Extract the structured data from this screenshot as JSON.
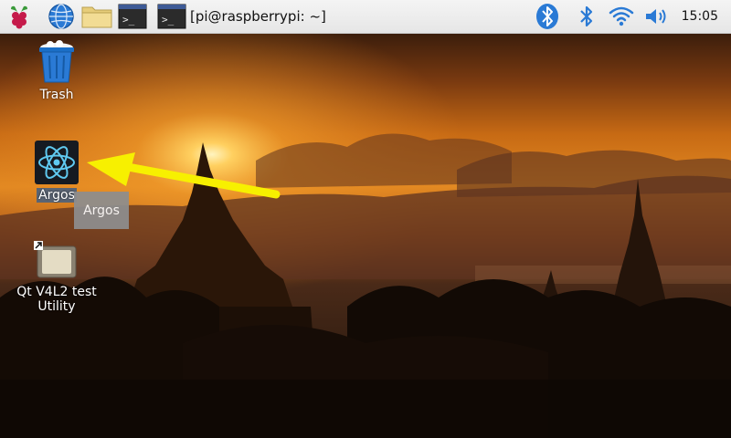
{
  "taskbar": {
    "menu_icon": "raspberry-pi-icon",
    "browser_icon": "globe-icon",
    "files_icon": "folder-icon",
    "terminal_icon": "terminal-icon",
    "task_title": "[pi@raspberrypi: ~]",
    "tray": {
      "bluetooth_icon": "bluetooth-icon",
      "bluetooth_status_icon": "bluetooth-icon",
      "wifi_icon": "wifi-icon",
      "volume_icon": "volume-icon",
      "clock": "15:05"
    }
  },
  "desktop": {
    "icons": [
      {
        "label": "Trash",
        "icon": "trash-icon"
      },
      {
        "label": "Argos",
        "icon": "react-atom-icon"
      },
      {
        "label": "Qt V4L2 test Utility",
        "icon": "qt-v4l2-app-icon"
      }
    ],
    "tooltip": "Argos",
    "annotation": {
      "icon": "yellow-arrow",
      "color": "#f7f000"
    }
  },
  "colors": {
    "accent_blue": "#2a7ad5",
    "arrow_yellow": "#f7f000",
    "raspberry_red": "#c51a4a"
  }
}
